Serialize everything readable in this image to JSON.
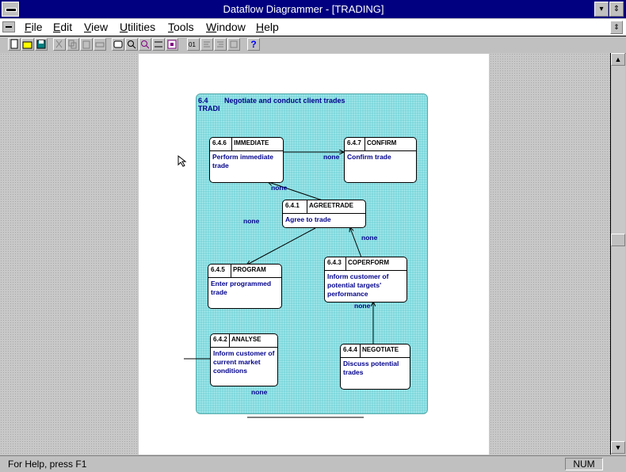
{
  "window": {
    "title": "Dataflow Diagrammer - [TRADING]",
    "minimize_glyph": "▾",
    "maximize_glyph": "⇕"
  },
  "menu": {
    "items": [
      "File",
      "Edit",
      "View",
      "Utilities",
      "Tools",
      "Window",
      "Help"
    ],
    "doc_restore_glyph": "⇕"
  },
  "toolbar": {
    "icons": [
      "new-icon",
      "open-icon",
      "save-icon",
      "cut-icon",
      "copy-icon",
      "paste-icon",
      "print-icon",
      "process-icon",
      "zoom-in-icon",
      "zoom-out-icon",
      "store-icon",
      "entity-icon",
      "label-icon",
      "align-left-icon",
      "align-right-icon",
      "properties-icon",
      "help-icon"
    ],
    "help_glyph": "?"
  },
  "diagram": {
    "header_number": "6.4",
    "header_title": "Negotiate and conduct client trades",
    "header_tag": "TRADI",
    "processes": [
      {
        "id": "6.4.6",
        "name": "IMMEDIATE",
        "desc": "Perform immediate trade"
      },
      {
        "id": "6.4.7",
        "name": "CONFIRM",
        "desc": "Confirm trade"
      },
      {
        "id": "6.4.1",
        "name": "AGREETRADE",
        "desc": "Agree to trade"
      },
      {
        "id": "6.4.5",
        "name": "PROGRAM",
        "desc": "Enter programmed trade"
      },
      {
        "id": "6.4.3",
        "name": "COPERFORM",
        "desc": "Inform customer of potential targets' performance"
      },
      {
        "id": "6.4.2",
        "name": "ANALYSE",
        "desc": "Inform customer of current market conditions"
      },
      {
        "id": "6.4.4",
        "name": "NEGOTIATE",
        "desc": "Discuss potential trades"
      }
    ],
    "flow_labels": [
      "none",
      "none",
      "none",
      "none",
      "none",
      "none"
    ]
  },
  "status": {
    "help_text": "For Help, press F1",
    "num_lock": "NUM"
  },
  "scrollbar": {
    "up_glyph": "▲",
    "down_glyph": "▼"
  }
}
